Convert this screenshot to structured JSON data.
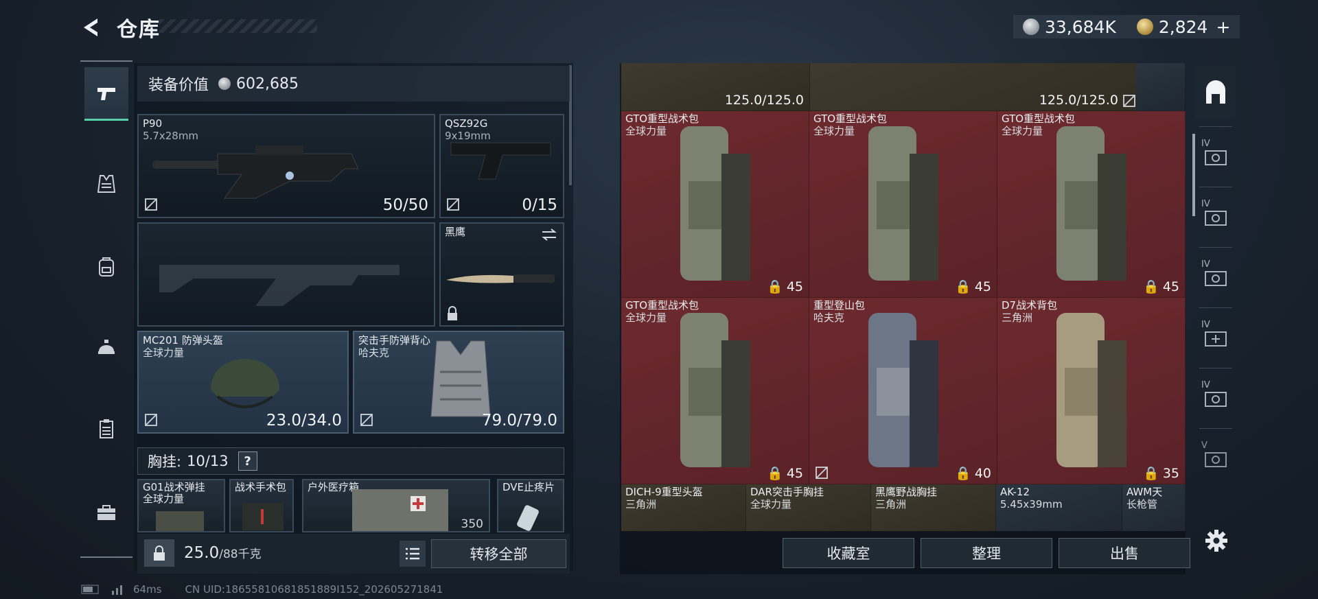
{
  "header": {
    "title": "仓库",
    "currency_silver": "33,684K",
    "currency_gold": "2,824",
    "currency_gold_plus": "+"
  },
  "left_panel": {
    "equipment_value_label": "装备价值",
    "equipment_value": "602,685",
    "primary_weapon": {
      "name": "P90",
      "caliber": "5.7x28mm",
      "ammo": "50/50"
    },
    "secondary_weapon": {
      "name": "QSZ92G",
      "caliber": "9x19mm",
      "ammo": "0/15"
    },
    "melee": {
      "name": "黑鹰"
    },
    "helmet": {
      "name": "MC201 防弹头盔",
      "faction": "全球力量",
      "durability": "23.0/34.0"
    },
    "armor": {
      "name": "突击手防弹背心",
      "faction": "哈夫克",
      "durability": "79.0/79.0"
    },
    "chest_rig_label": "胸挂:",
    "chest_rig_value": "10/13",
    "chest_rig_help": "?",
    "chest_items": [
      {
        "name": "G01战术弹挂",
        "faction": "全球力量"
      },
      {
        "name": "战术手术包"
      },
      {
        "name": "户外医疗箱",
        "count": "350"
      },
      {
        "name": "DVE止疼片"
      }
    ],
    "weight_value": "25.0",
    "weight_unit": "/88千克",
    "transfer_all": "转移全部"
  },
  "status": {
    "ping": "64ms",
    "uid": "CN UID:18655810681851889I152_202605271841"
  },
  "grid": {
    "top_row": [
      {
        "cap": "125.0/125.0"
      },
      {
        "cap": "125.0/125.0"
      }
    ],
    "bags": [
      {
        "name": "GTO重型战术包",
        "faction": "全球力量",
        "cap": "45",
        "color": "#7d8270"
      },
      {
        "name": "GTO重型战术包",
        "faction": "全球力量",
        "cap": "45",
        "color": "#7d8270"
      },
      {
        "name": "GTO重型战术包",
        "faction": "全球力量",
        "cap": "45",
        "color": "#7d8270"
      },
      {
        "name": "GTO重型战术包",
        "faction": "全球力量",
        "cap": "45",
        "color": "#7d8270"
      },
      {
        "name": "重型登山包",
        "faction": "哈夫克",
        "cap": "40",
        "color": "#6d7687"
      },
      {
        "name": "D7战术背包",
        "faction": "三角洲",
        "cap": "35",
        "color": "#a79b80"
      }
    ],
    "bottom_row": [
      {
        "name": "DICH-9重型头盔",
        "faction": "三角洲"
      },
      {
        "name": "DAR突击手胸挂",
        "faction": "全球力量"
      },
      {
        "name": "黑鹰野战胸挂",
        "faction": "三角洲"
      },
      {
        "name": "AK-12",
        "faction": "5.45x39mm"
      },
      {
        "name": "AWM天",
        "faction": "长枪管"
      }
    ]
  },
  "buttons": {
    "collection": "收藏室",
    "organize": "整理",
    "sell": "出售"
  },
  "right_nav": [
    {
      "icon": "home-shelter-icon",
      "label": ""
    },
    {
      "icon": "camera-storage-icon",
      "label": "IV"
    },
    {
      "icon": "camera-storage-icon",
      "label": "IV"
    },
    {
      "icon": "camera-storage-icon",
      "label": "IV"
    },
    {
      "icon": "camera-storage-add-icon",
      "label": "IV"
    },
    {
      "icon": "camera-storage-icon",
      "label": "IV"
    },
    {
      "icon": "camera-storage-icon",
      "label": "V"
    }
  ],
  "colors": {
    "accent_green": "#57d0a8",
    "grid_red": "#6d2a2f"
  }
}
